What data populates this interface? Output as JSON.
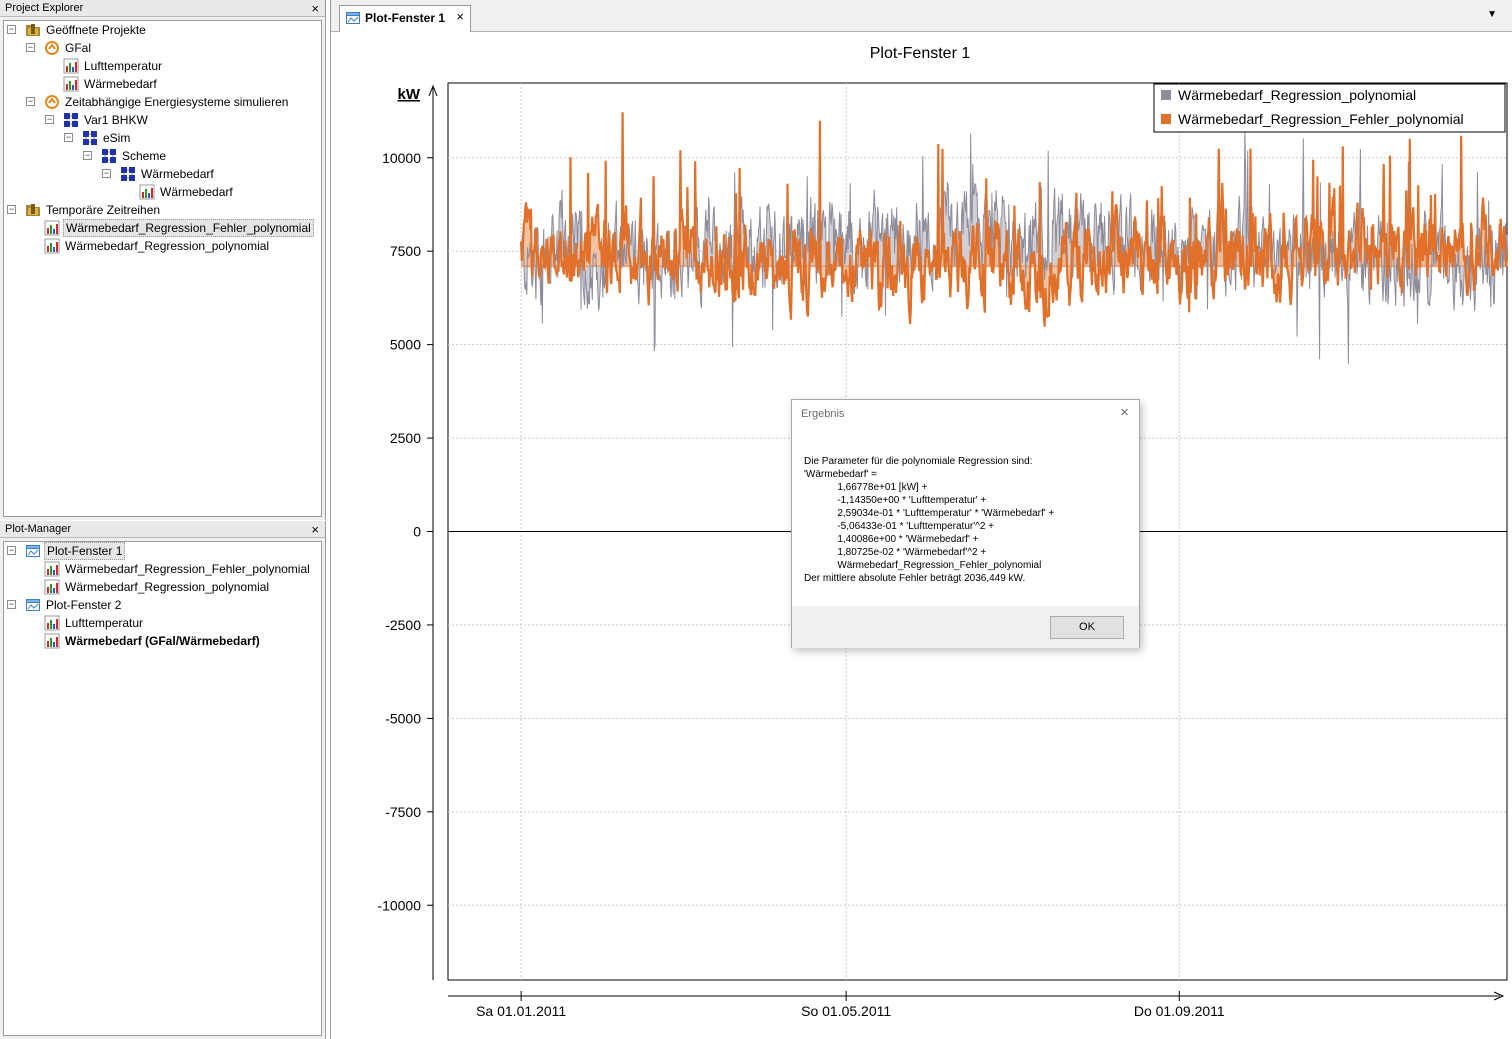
{
  "project_explorer": {
    "title": "Project Explorer",
    "items": [
      {
        "label": "Geöffnete Projekte",
        "icon": "project-folder-icon"
      },
      {
        "label": "GFal",
        "icon": "project-icon"
      },
      {
        "label": "Lufttemperatur",
        "icon": "timeseries-icon"
      },
      {
        "label": "Wärmebedarf",
        "icon": "timeseries-icon"
      },
      {
        "label": "Zeitabhängige Energiesysteme simulieren",
        "icon": "project-icon"
      },
      {
        "label": "Var1 BHKW",
        "icon": "scheme-icon"
      },
      {
        "label": "eSim",
        "icon": "scheme-icon"
      },
      {
        "label": "Scheme",
        "icon": "scheme-icon"
      },
      {
        "label": "Wärmebedarf",
        "icon": "scheme-icon"
      },
      {
        "label": "Wärmebedarf",
        "icon": "timeseries-icon"
      },
      {
        "label": "Temporäre Zeitreihen",
        "icon": "project-folder-icon"
      },
      {
        "label": "Wärmebedarf_Regression_Fehler_polynomial",
        "icon": "timeseries-icon"
      },
      {
        "label": "Wärmebedarf_Regression_polynomial",
        "icon": "timeseries-icon"
      }
    ]
  },
  "plot_manager": {
    "title": "Plot-Manager",
    "items": [
      {
        "label": "Plot-Fenster 1",
        "icon": "plot-window-icon"
      },
      {
        "label": "Wärmebedarf_Regression_Fehler_polynomial",
        "icon": "timeseries-icon"
      },
      {
        "label": "Wärmebedarf_Regression_polynomial",
        "icon": "timeseries-icon"
      },
      {
        "label": "Plot-Fenster 2",
        "icon": "plot-window-icon"
      },
      {
        "label": "Lufttemperatur",
        "icon": "timeseries-icon"
      },
      {
        "label": "Wärmebedarf (GFal/Wärmebedarf)",
        "icon": "timeseries-icon"
      }
    ]
  },
  "tab": {
    "label": "Plot-Fenster 1",
    "close": "×",
    "dropdown": "▼"
  },
  "panel_close": "×",
  "colors": {
    "series_grey": "#8f8c9a",
    "series_orange": "#e0702a",
    "orange_fill": "#f0b48c",
    "grey_fill": "#c4c3cc"
  },
  "chart_data": {
    "type": "area",
    "title": "Plot-Fenster 1",
    "ylabel": "kW",
    "ylim": [
      -12000,
      12000
    ],
    "yticks": [
      10000,
      7500,
      5000,
      2500,
      0,
      -2500,
      -5000,
      -7500,
      -10000
    ],
    "ytick_labels": [
      "10000",
      "7500",
      "5000",
      "2500",
      "0",
      "-2500",
      "-5000",
      "-7500",
      "-10000"
    ],
    "xticks": [
      "Sa 01.01.2011",
      "So 01.05.2011",
      "Do 01.09.2011"
    ],
    "x_range": [
      "2010-12-05",
      "2011-12-31"
    ],
    "grid": true,
    "legend_position": "top-right",
    "baseline": 7100,
    "series": [
      {
        "name": "Wärmebedarf_Regression_polynomial",
        "color": "#8f8c9a",
        "approx_range": [
          2100,
          10700
        ],
        "mean": 7100
      },
      {
        "name": "Wärmebedarf_Regression_Fehler_polynomial",
        "color": "#e0702a",
        "approx_range": [
          4700,
          11300
        ],
        "mean": 7100
      }
    ]
  },
  "dialog": {
    "title": "Ergebnis",
    "close": "×",
    "text_lines": [
      "Die Parameter für die polynomiale Regression sind:",
      "'Wärmebedarf' =",
      "            1,66778e+01 [kW] +",
      "            -1,14350e+00 * 'Lufttemperatur' +",
      "            2,59034e-01 * 'Lufttemperatur' * 'Wärmebedarf' +",
      "            -5,06433e-01 * 'Lufttemperatur'^2 +",
      "            1,40086e+00 * 'Wärmebedarf' +",
      "            1,80725e-02 * 'Wärmebedarf'^2 +",
      "            Wärmebedarf_Regression_Fehler_polynomial",
      "Der mittlere absolute Fehler beträgt 2036,449 kW."
    ],
    "ok_label": "OK"
  }
}
